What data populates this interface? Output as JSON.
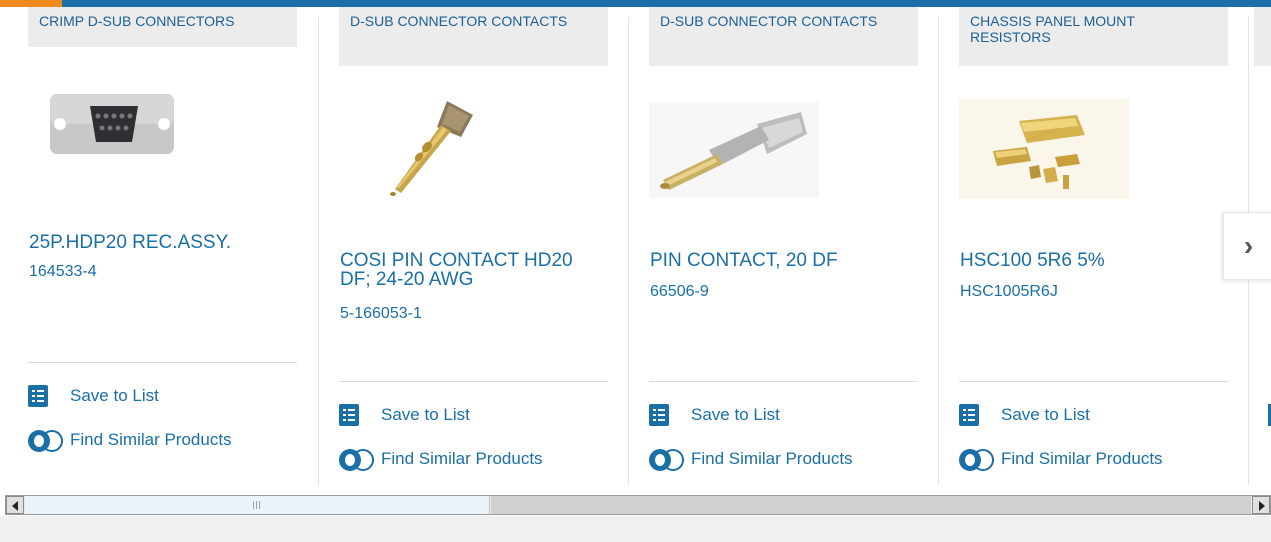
{
  "colors": {
    "brand_blue": "#1a6fa6",
    "accent_orange": "#f08a1c",
    "category_bg": "#ececec"
  },
  "cards": [
    {
      "category": "CRIMP D-SUB CONNECTORS",
      "title": "25P.HDP20 REC.ASSY.",
      "part_number": "164533-4",
      "image": "d-sub-connector-shell"
    },
    {
      "category": "D-SUB CONNECTOR CONTACTS",
      "title": "COSI PIN CONTACT HD20 DF; 24-20 AWG",
      "part_number": "5-166053-1",
      "image": "pin-contact-gold"
    },
    {
      "category": "D-SUB CONNECTOR CONTACTS",
      "title": "PIN CONTACT, 20 DF",
      "part_number": "66506-9",
      "image": "pin-contact-silver"
    },
    {
      "category": "CHASSIS PANEL MOUNT RESISTORS",
      "title": "HSC100 5R6 5%",
      "part_number": "HSC1005R6J",
      "image": "chassis-resistors-gold"
    }
  ],
  "actions": {
    "save": "Save to List",
    "similar": "Find Similar Products"
  },
  "nav": {
    "next_icon": "chevron-right-icon",
    "next_glyph": "›"
  },
  "scrollbar": {
    "left_icon": "arrow-left-icon",
    "right_icon": "arrow-right-icon"
  }
}
